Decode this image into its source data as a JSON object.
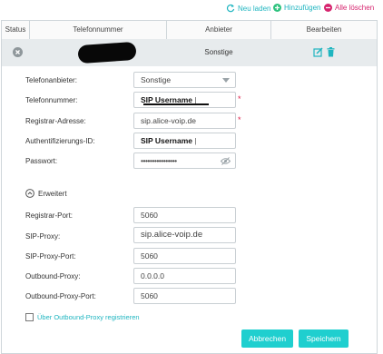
{
  "toolbar": {
    "reload_label": "Neu laden",
    "add_label": "Hinzufügen",
    "delete_all_label": "Alle löschen"
  },
  "table": {
    "headers": [
      "Status",
      "Telefonnummer",
      "Anbieter",
      "Bearbeiten"
    ],
    "row": {
      "provider": "Sonstige"
    }
  },
  "form": {
    "provider_label": "Telefonanbieter:",
    "provider_value": "Sonstige",
    "phone_label": "Telefonnummer:",
    "phone_value": "SIP Username",
    "registrar_label": "Registrar-Adresse:",
    "registrar_value": "sip.alice-voip.de",
    "auth_label": "Authentifizierungs-ID:",
    "auth_value": "SIP Username",
    "password_label": "Passwort:",
    "password_value": "••••••••••••••••",
    "advanced_label": "Erweitert",
    "reg_port_label": "Registrar-Port:",
    "reg_port_value": "5060",
    "sip_proxy_label": "SIP-Proxy:",
    "sip_proxy_value": "sip.alice-voip.de",
    "sip_proxy_port_label": "SIP-Proxy-Port:",
    "sip_proxy_port_value": "5060",
    "outbound_proxy_label": "Outbound-Proxy:",
    "outbound_proxy_value": "0.0.0.0",
    "outbound_port_label": "Outbound-Proxy-Port:",
    "outbound_port_value": "5060",
    "checkbox_label": "Über Outbound-Proxy registrieren",
    "cancel_label": "Abbrechen",
    "save_label": "Speichern"
  },
  "colors": {
    "accent": "#1fcfcf",
    "add_green": "#2ec27e",
    "delete_red": "#d6246e",
    "required": "#e0204c"
  },
  "icons": [
    "refresh-icon",
    "plus-icon",
    "minus-icon",
    "status-x-icon",
    "edit-icon",
    "trash-icon",
    "chevron-down-icon",
    "eye-off-icon",
    "collapse-icon"
  ]
}
